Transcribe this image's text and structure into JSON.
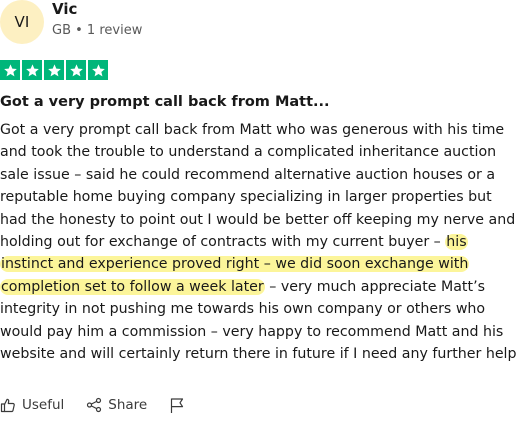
{
  "reviewer": {
    "initials": "VI",
    "name": "Vic",
    "meta": "GB • 1 review"
  },
  "rating": {
    "stars": 5,
    "color": "#00b67a"
  },
  "review": {
    "title": "Got a very prompt call back from Matt...",
    "lines": [
      [
        {
          "text": "Got a very prompt call back from Matt who was generous with his time"
        }
      ],
      [
        {
          "text": "and took the trouble to understand a complicated inheritance auction"
        }
      ],
      [
        {
          "text": "sale issue – said he could recommend alternative auction houses or a"
        }
      ],
      [
        {
          "text": "reputable home buying company specializing in larger properties but"
        }
      ],
      [
        {
          "text": "had the honesty to point out I would be better off keeping my nerve and"
        }
      ],
      [
        {
          "text": "holding out for exchange of contracts with my current buyer – "
        },
        {
          "text": "his",
          "highlight": true
        }
      ],
      [
        {
          "text": "instinct and experience proved right – we did soon exchange with",
          "highlight": true
        }
      ],
      [
        {
          "text": "completion set to follow a week later",
          "highlight": true
        },
        {
          "text": " – very much appreciate Matt’s"
        }
      ],
      [
        {
          "text": "integrity in not pushing me towards his own company or others who"
        }
      ],
      [
        {
          "text": "would pay him a commission – very happy to recommend Matt and his"
        }
      ],
      [
        {
          "text": "website and will certainly return there in future if I need any further help"
        }
      ]
    ],
    "highlight_color": "#fcf59a"
  },
  "actions": {
    "useful_label": "Useful",
    "share_label": "Share",
    "useful_icon": "thumbs-up-icon",
    "share_icon": "share-icon",
    "report_icon": "flag-icon"
  }
}
